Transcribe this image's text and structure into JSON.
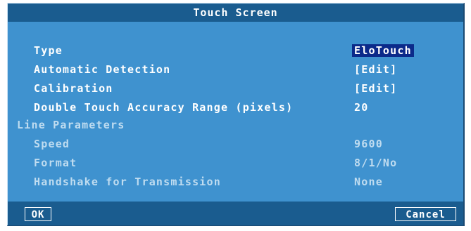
{
  "dialog": {
    "title": "Touch Screen"
  },
  "fields": [
    {
      "label": "Type",
      "value": "EloTouch"
    },
    {
      "label": "Automatic Detection",
      "value": "[Edit]"
    },
    {
      "label": "Calibration",
      "value": "[Edit]"
    },
    {
      "label": "Double Touch Accuracy Range (pixels)",
      "value": "20"
    }
  ],
  "line_parameters": {
    "heading": "Line Parameters",
    "fields": [
      {
        "label": "Speed",
        "value": "9600"
      },
      {
        "label": "Format",
        "value": "8/1/No"
      },
      {
        "label": "Handshake for Transmission",
        "value": "None"
      }
    ]
  },
  "buttons": {
    "ok": "OK",
    "cancel": "Cancel"
  },
  "colors": {
    "panel": "#3f92cf",
    "title_bar": "#1a5c8f",
    "focus": "#0b2a8a",
    "muted_text": "#bfdcf0"
  }
}
